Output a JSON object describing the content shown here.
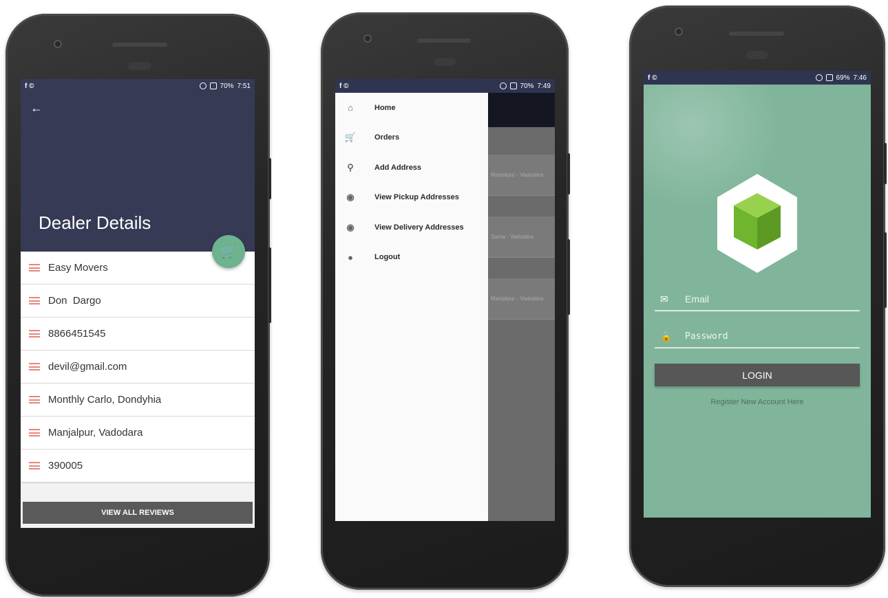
{
  "dealer_screen": {
    "status": {
      "left_icons": "f ©",
      "battery": "70%",
      "time": "7:51"
    },
    "title": "Dealer Details",
    "back_icon": "arrow-left-icon",
    "cart_icon": "cart-icon",
    "rows": [
      "Easy Movers",
      "Don  Dargo",
      "8866451545",
      "devil@gmail.com",
      "Monthly Carlo, Dondyhia",
      "Manjalpur, Vadodara",
      "390005"
    ],
    "reviews_button": "VIEW ALL REVIEWS",
    "colors": {
      "header": "#363a55",
      "fab": "#6cb38e",
      "row_icon": "#e8857a"
    }
  },
  "drawer_screen": {
    "status": {
      "left_icons": "f ©",
      "battery": "70%",
      "time": "7:49"
    },
    "menu": [
      {
        "label": "Home",
        "icon": "home-icon"
      },
      {
        "label": "Orders",
        "icon": "cart-icon"
      },
      {
        "label": "Add Address",
        "icon": "location-pin-icon"
      },
      {
        "label": "View Pickup Addresses",
        "icon": "target-icon"
      },
      {
        "label": "View Delivery Addresses",
        "icon": "target-icon"
      },
      {
        "label": "Logout",
        "icon": "person-icon"
      }
    ],
    "background_cards": [
      "Manjalpur - Vadodara",
      "Sama - Vadodara",
      "Manjalpur - Vadodara"
    ]
  },
  "login_screen": {
    "status": {
      "left_icons": "f ©",
      "battery": "69%",
      "time": "7:46"
    },
    "email_placeholder": "Email",
    "password_placeholder": "Password",
    "login_button": "LOGIN",
    "register_link": "Register New Account Here",
    "colors": {
      "background": "#80b59b",
      "button": "#575757",
      "cube": "#7cc242"
    }
  }
}
